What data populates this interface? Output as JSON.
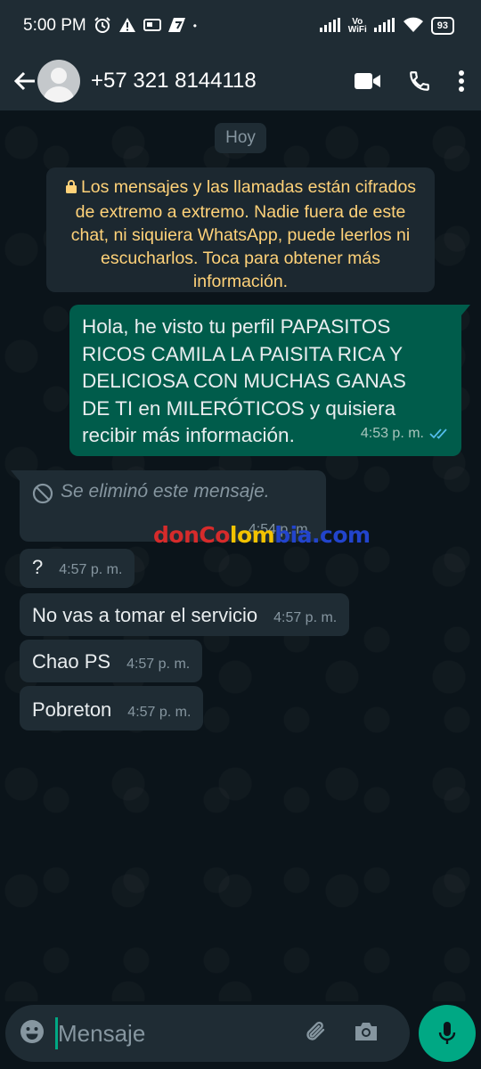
{
  "status_bar": {
    "time": "5:00 PM",
    "network_label_top": "Vo",
    "network_label_bottom": "WiFi",
    "battery": "93",
    "icons": [
      "alarm-icon",
      "warning-icon",
      "sim-card-icon",
      "app-notification-icon",
      "signal-icon",
      "wifi-icon",
      "battery-icon"
    ]
  },
  "header": {
    "contact": "+57 321 8144118",
    "icons": [
      "back-arrow-icon",
      "avatar",
      "video-call-icon",
      "phone-icon",
      "more-vert-icon"
    ]
  },
  "chat": {
    "date_chip": "Hoy",
    "encryption_notice": "Los mensajes y las llamadas están cifrados de extremo a extremo. Nadie fuera de este chat, ni siquiera WhatsApp, puede leerlos ni escucharlos. Toca para obtener más información.",
    "outgoing": {
      "text": "Hola, he visto tu perfil PAPASITOS RICOS CAMILA LA PAISITA RICA Y DELICIOSA CON MUCHAS GANAS DE TI en MILERÓTICOS y quisiera recibir más información.",
      "time": "4:53 p. m.",
      "status": "read"
    },
    "deleted": {
      "text": "Se eliminó este mensaje.",
      "time": "4:54 p. m."
    },
    "incoming": [
      {
        "text": "?",
        "time": "4:57 p. m."
      },
      {
        "text": "No vas a tomar el servicio",
        "time": "4:57 p. m."
      },
      {
        "text": "Chao PS",
        "time": "4:57 p. m."
      },
      {
        "text": "Pobreton",
        "time": "4:57 p. m."
      }
    ],
    "watermark": {
      "part_a": "donCo",
      "part_b": "lom",
      "part_c": "bia.com"
    }
  },
  "input": {
    "placeholder": "Mensaje"
  },
  "colors": {
    "background": "#0b141a",
    "bar": "#1f2c34",
    "outgoing_bubble": "#005c4b",
    "accent": "#00a884",
    "notice_text": "#ffd279",
    "read_ticks": "#53bdeb"
  }
}
